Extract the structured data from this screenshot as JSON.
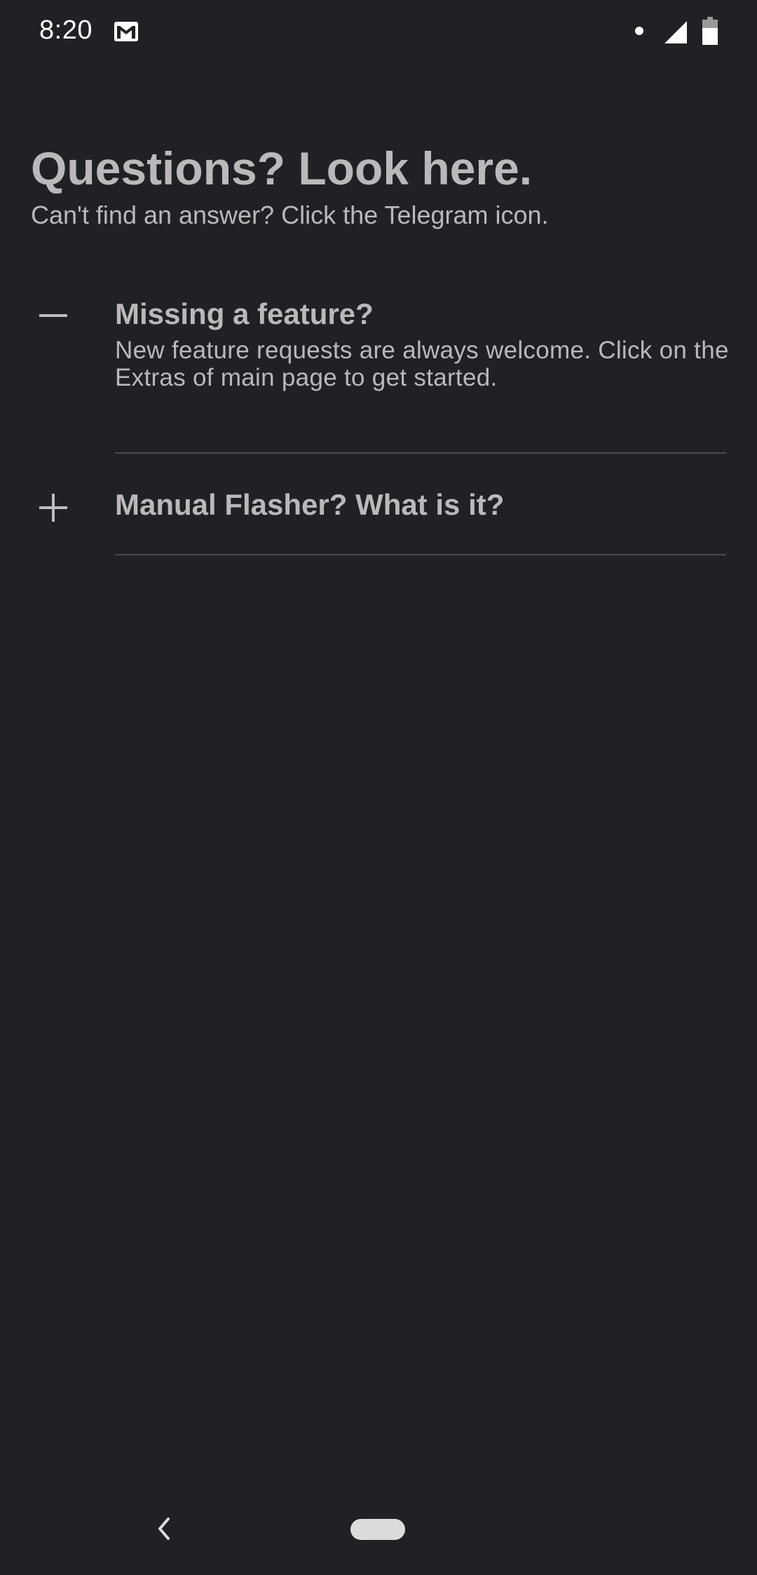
{
  "status_bar": {
    "time": "8:20",
    "icons": [
      "gmail-icon",
      "notification-dot-icon",
      "cell-signal-icon",
      "battery-icon"
    ]
  },
  "header": {
    "title": "Questions? Look here.",
    "subtitle": "Can't find an answer? Click the Telegram icon."
  },
  "faq": {
    "items": [
      {
        "question": "Missing a feature?",
        "answer": "New feature requests are always welcome. Click on the Extras of main page to get started.",
        "expanded": true,
        "toggle_icon": "minus-icon"
      },
      {
        "question": "Manual Flasher? What is it?",
        "answer": "",
        "expanded": false,
        "toggle_icon": "plus-icon"
      }
    ]
  },
  "nav_bar": {
    "icons": [
      "back-icon",
      "home-pill"
    ]
  },
  "colors": {
    "background": "#202125",
    "text": "#b9b9bb",
    "divider": "#4a4b4f",
    "status_text": "#ffffff"
  }
}
